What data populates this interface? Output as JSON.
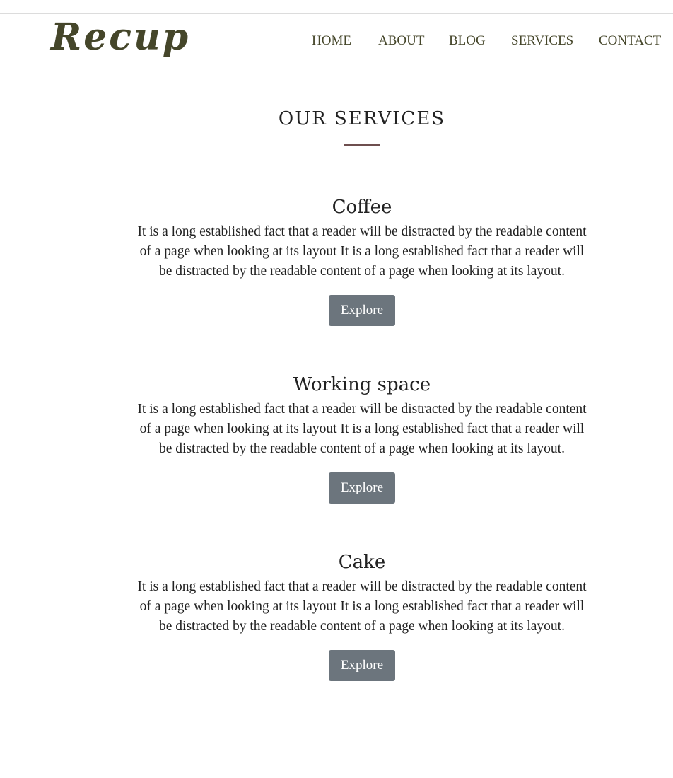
{
  "brand": {
    "logo_text": "Recup",
    "logo_color": "#45462a"
  },
  "nav": {
    "items": [
      {
        "label": "HOME"
      },
      {
        "label": "ABOUT"
      },
      {
        "label": "BLOG"
      },
      {
        "label": "SERVICES"
      },
      {
        "label": "CONTACT"
      }
    ]
  },
  "main": {
    "section_title": "OUR SERVICES",
    "accent_color": "#6e4f4f",
    "services": [
      {
        "title": "Coffee",
        "description": "It is a long established fact that a reader will be distracted by the readable content of a page when looking at its layout It is a long established fact that a reader will be distracted by the readable content of a page when looking at its layout.",
        "button_label": "Explore"
      },
      {
        "title": "Working space",
        "description": "It is a long established fact that a reader will be distracted by the readable content of a page when looking at its layout It is a long established fact that a reader will be distracted by the readable content of a page when looking at its layout.",
        "button_label": "Explore"
      },
      {
        "title": "Cake",
        "description": "It is a long established fact that a reader will be distracted by the readable content of a page when looking at its layout It is a long established fact that a reader will be distracted by the readable content of a page when looking at its layout.",
        "button_label": "Explore"
      }
    ],
    "button_color": "#6c757d"
  }
}
